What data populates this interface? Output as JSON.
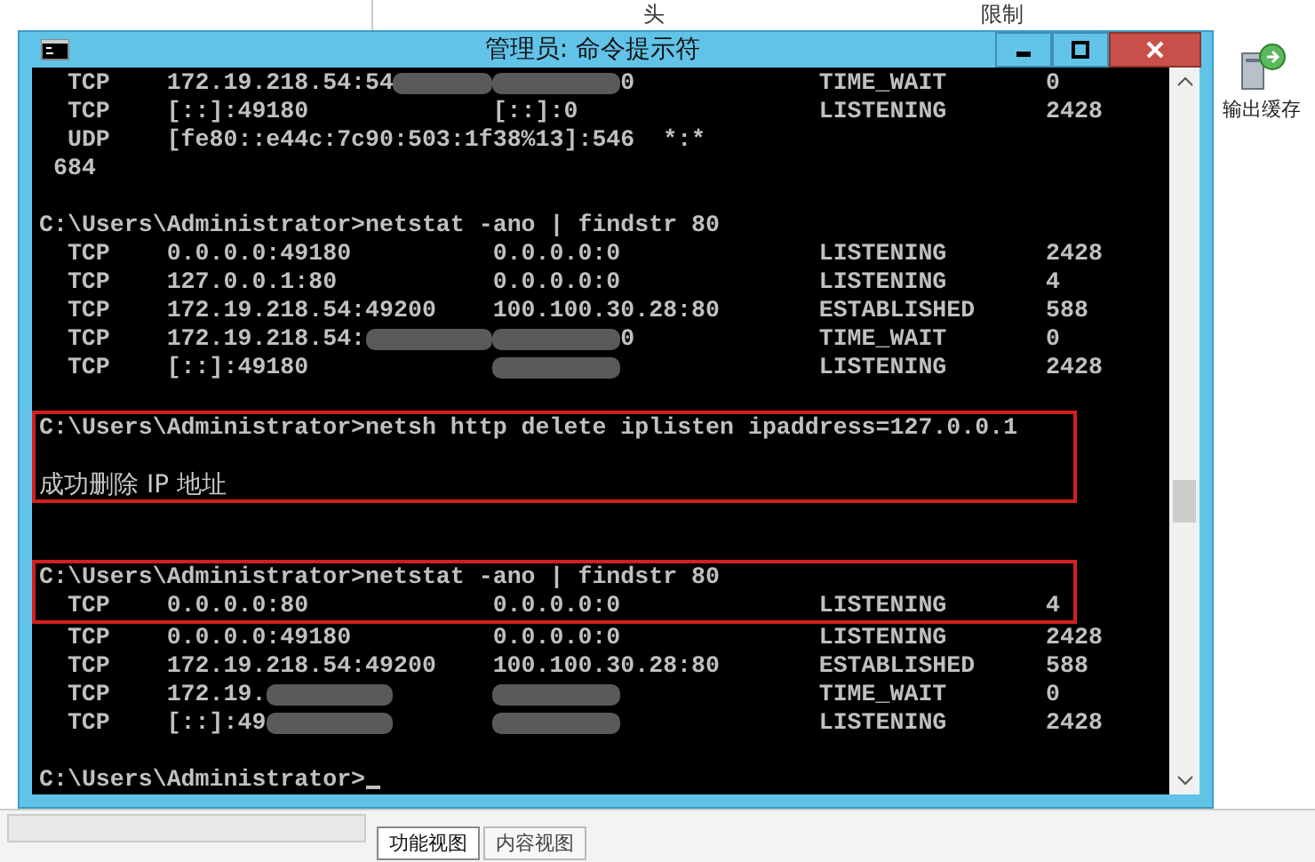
{
  "background_app": {
    "column_headers": [
      "头",
      "限制"
    ],
    "action_item": {
      "label": "输出缓存"
    },
    "view_tabs": [
      {
        "label": "功能视图",
        "selected": true
      },
      {
        "label": "内容视图",
        "selected": false
      }
    ]
  },
  "window": {
    "title": "管理员: 命令提示符",
    "blocks": [
      {
        "highlighted": false,
        "lines": [
          {
            "kind": "row",
            "cells": [
              [
                {
                  "kind": "text",
                  "text": "TCP"
                }
              ],
              [
                {
                  "kind": "text",
                  "text": "172.19.218.54:54"
                },
                {
                  "kind": "blur"
                }
              ],
              [
                {
                  "kind": "blur"
                },
                {
                  "kind": "text",
                  "text": "0"
                }
              ],
              [
                {
                  "kind": "text",
                  "text": "TIME_WAIT"
                }
              ],
              [
                {
                  "kind": "text",
                  "text": "0"
                }
              ]
            ]
          },
          {
            "kind": "row",
            "cells": [
              [
                {
                  "kind": "text",
                  "text": "TCP"
                }
              ],
              [
                {
                  "kind": "text",
                  "text": "[::]:49180"
                }
              ],
              [
                {
                  "kind": "text",
                  "text": "[::]:0"
                }
              ],
              [
                {
                  "kind": "text",
                  "text": "LISTENING"
                }
              ],
              [
                {
                  "kind": "text",
                  "text": "2428"
                }
              ]
            ]
          },
          {
            "kind": "text",
            "text": "  UDP    [fe80::e44c:7c90:503:1f38%13]:546  *:*"
          },
          {
            "kind": "text",
            "text": " 684"
          },
          {
            "kind": "blank"
          },
          {
            "kind": "text",
            "text": "C:\\Users\\Administrator>netstat -ano | findstr 80"
          },
          {
            "kind": "row",
            "cells": [
              [
                {
                  "kind": "text",
                  "text": "TCP"
                }
              ],
              [
                {
                  "kind": "text",
                  "text": "0.0.0.0:49180"
                }
              ],
              [
                {
                  "kind": "text",
                  "text": "0.0.0.0:0"
                }
              ],
              [
                {
                  "kind": "text",
                  "text": "LISTENING"
                }
              ],
              [
                {
                  "kind": "text",
                  "text": "2428"
                }
              ]
            ]
          },
          {
            "kind": "row",
            "cells": [
              [
                {
                  "kind": "text",
                  "text": "TCP"
                }
              ],
              [
                {
                  "kind": "text",
                  "text": "127.0.0.1:80"
                }
              ],
              [
                {
                  "kind": "text",
                  "text": "0.0.0.0:0"
                }
              ],
              [
                {
                  "kind": "text",
                  "text": "LISTENING"
                }
              ],
              [
                {
                  "kind": "text",
                  "text": "4"
                }
              ]
            ]
          },
          {
            "kind": "row",
            "cells": [
              [
                {
                  "kind": "text",
                  "text": "TCP"
                }
              ],
              [
                {
                  "kind": "text",
                  "text": "172.19.218.54:49200"
                }
              ],
              [
                {
                  "kind": "text",
                  "text": "100.100.30.28:80"
                }
              ],
              [
                {
                  "kind": "text",
                  "text": "ESTABLISHED"
                }
              ],
              [
                {
                  "kind": "text",
                  "text": "588"
                }
              ]
            ]
          },
          {
            "kind": "row",
            "cells": [
              [
                {
                  "kind": "text",
                  "text": "TCP"
                }
              ],
              [
                {
                  "kind": "text",
                  "text": "172.19.218.54:"
                },
                {
                  "kind": "blur"
                }
              ],
              [
                {
                  "kind": "blur"
                },
                {
                  "kind": "text",
                  "text": "0"
                }
              ],
              [
                {
                  "kind": "text",
                  "text": "TIME_WAIT"
                }
              ],
              [
                {
                  "kind": "text",
                  "text": "0"
                }
              ]
            ]
          },
          {
            "kind": "row",
            "cells": [
              [
                {
                  "kind": "text",
                  "text": "TCP"
                }
              ],
              [
                {
                  "kind": "text",
                  "text": "[::]:49180"
                }
              ],
              [
                {
                  "kind": "blur"
                }
              ],
              [
                {
                  "kind": "text",
                  "text": "LISTENING"
                }
              ],
              [
                {
                  "kind": "text",
                  "text": "2428"
                }
              ]
            ]
          },
          {
            "kind": "blank"
          }
        ]
      },
      {
        "highlighted": true,
        "lines": [
          {
            "kind": "text",
            "text": "C:\\Users\\Administrator>netsh http delete iplisten ipaddress=127.0.0.1"
          },
          {
            "kind": "blank"
          },
          {
            "kind": "message",
            "text": "成功删除 IP 地址"
          }
        ]
      },
      {
        "highlighted": false,
        "lines": [
          {
            "kind": "blank"
          },
          {
            "kind": "blank"
          }
        ]
      },
      {
        "highlighted": true,
        "lines": [
          {
            "kind": "text",
            "text": "C:\\Users\\Administrator>netstat -ano | findstr 80"
          },
          {
            "kind": "row",
            "cells": [
              [
                {
                  "kind": "text",
                  "text": "TCP"
                }
              ],
              [
                {
                  "kind": "text",
                  "text": "0.0.0.0:80"
                }
              ],
              [
                {
                  "kind": "text",
                  "text": "0.0.0.0:0"
                }
              ],
              [
                {
                  "kind": "text",
                  "text": "LISTENING"
                }
              ],
              [
                {
                  "kind": "text",
                  "text": "4"
                }
              ]
            ]
          }
        ]
      },
      {
        "highlighted": false,
        "lines": [
          {
            "kind": "row",
            "cells": [
              [
                {
                  "kind": "text",
                  "text": "TCP"
                }
              ],
              [
                {
                  "kind": "text",
                  "text": "0.0.0.0:49180"
                }
              ],
              [
                {
                  "kind": "text",
                  "text": "0.0.0.0:0"
                }
              ],
              [
                {
                  "kind": "text",
                  "text": "LISTENING"
                }
              ],
              [
                {
                  "kind": "text",
                  "text": "2428"
                }
              ]
            ]
          },
          {
            "kind": "row",
            "cells": [
              [
                {
                  "kind": "text",
                  "text": "TCP"
                }
              ],
              [
                {
                  "kind": "text",
                  "text": "172.19.218.54:49200"
                }
              ],
              [
                {
                  "kind": "text",
                  "text": "100.100.30.28:80"
                }
              ],
              [
                {
                  "kind": "text",
                  "text": "ESTABLISHED"
                }
              ],
              [
                {
                  "kind": "text",
                  "text": "588"
                }
              ]
            ]
          },
          {
            "kind": "row",
            "cells": [
              [
                {
                  "kind": "text",
                  "text": "TCP"
                }
              ],
              [
                {
                  "kind": "text",
                  "text": "172.19."
                },
                {
                  "kind": "blur"
                }
              ],
              [
                {
                  "kind": "blur"
                }
              ],
              [
                {
                  "kind": "text",
                  "text": "TIME_WAIT"
                }
              ],
              [
                {
                  "kind": "text",
                  "text": "0"
                }
              ]
            ]
          },
          {
            "kind": "row",
            "cells": [
              [
                {
                  "kind": "text",
                  "text": "TCP"
                }
              ],
              [
                {
                  "kind": "text",
                  "text": "[::]:49"
                },
                {
                  "kind": "blur"
                }
              ],
              [
                {
                  "kind": "blur"
                }
              ],
              [
                {
                  "kind": "text",
                  "text": "LISTENING"
                }
              ],
              [
                {
                  "kind": "text",
                  "text": "2428"
                }
              ]
            ]
          },
          {
            "kind": "blank"
          },
          {
            "kind": "prompt",
            "text": "C:\\Users\\Administrator>"
          }
        ]
      }
    ]
  }
}
